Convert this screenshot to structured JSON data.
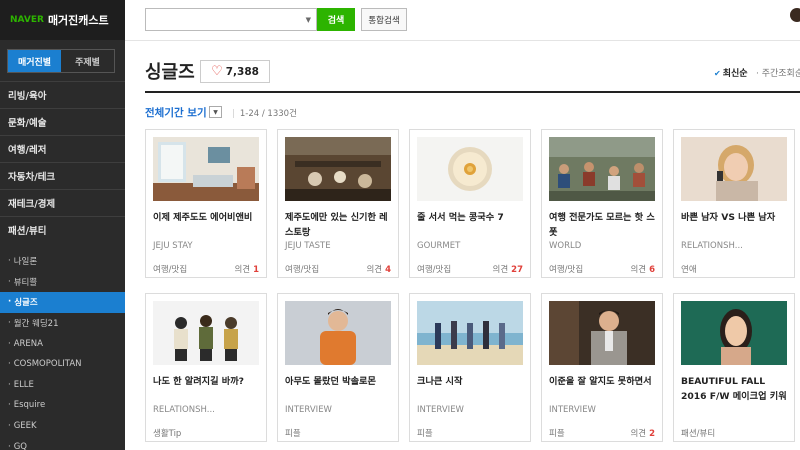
{
  "brand": {
    "naver": "NAVER",
    "title": "매거진캐스트"
  },
  "sidebar": {
    "tabs": [
      {
        "label": "매거진별",
        "active": true
      },
      {
        "label": "주제별",
        "active": false
      }
    ],
    "categories": [
      "리빙/육아",
      "문화/예술",
      "여행/레저",
      "자동차/테크",
      "재테크/경제",
      "패션/뷰티"
    ],
    "magazines": [
      "나일론",
      "뷰티쁠",
      "싱글즈",
      "월간 웨딩21",
      "ARENA",
      "COSMOPOLITAN",
      "ELLE",
      "Esquire",
      "GEEK",
      "GQ"
    ],
    "active_magazine": "싱글즈"
  },
  "topbar": {
    "search_placeholder": "",
    "search_value": "",
    "search_button": "검색",
    "total_search_button": "통합검색"
  },
  "header": {
    "title": "싱글즈",
    "likes": "7,388",
    "sort_latest": "최신순",
    "sort_weekly": "· 주간조회순"
  },
  "filter": {
    "label": "전체기간 보기",
    "range": "1-24 / 1330건"
  },
  "cards": [
    {
      "title": "이제 제주도도 에어비앤비",
      "magazine": "JEJU STAY",
      "category": "여행/맛집",
      "comment_label": "의견",
      "comments": "1",
      "thumb": "room"
    },
    {
      "title": "제주도에만 있는 신기한 레스토랑",
      "magazine": "JEJU TASTE",
      "category": "여행/맛집",
      "comment_label": "의견",
      "comments": "4",
      "thumb": "restaurant"
    },
    {
      "title": "줄 서서 먹는 콩국수 7",
      "magazine": "GOURMET",
      "category": "여행/맛집",
      "comment_label": "의견",
      "comments": "27",
      "thumb": "noodle"
    },
    {
      "title": "여행 전문가도 모르는 핫 스폿",
      "magazine": "WORLD",
      "category": "여행/맛집",
      "comment_label": "의견",
      "comments": "6",
      "thumb": "crowd"
    },
    {
      "title": "바쁜 남자 VS 나쁜 남자",
      "magazine": "RELATIONSH...",
      "category": "연애",
      "comment_label": "",
      "comments": "",
      "thumb": "woman-phone"
    },
    {
      "title": "나도 한 알려지길 바까?",
      "magazine": "RELATIONSH...",
      "category": "생활Tip",
      "comment_label": "",
      "comments": "",
      "thumb": "three-people"
    },
    {
      "title": "아무도 몰랐던 박솔로몬",
      "magazine": "INTERVIEW",
      "category": "피플",
      "comment_label": "",
      "comments": "",
      "thumb": "man-orange"
    },
    {
      "title": "크나큰 시작",
      "magazine": "INTERVIEW",
      "category": "피플",
      "comment_label": "",
      "comments": "",
      "thumb": "beach-group"
    },
    {
      "title": "이준을 잘 알지도 못하면서",
      "magazine": "INTERVIEW",
      "category": "피플",
      "comment_label": "의견",
      "comments": "2",
      "thumb": "man-suit"
    },
    {
      "title": "BEAUTIFUL FALL 2016 F/W 메이크업 키워",
      "magazine": "",
      "category": "패션/뷰티",
      "comment_label": "",
      "comments": "",
      "thumb": "woman-green"
    }
  ],
  "colors": {
    "accent_blue": "#1b7fd0",
    "naver_green": "#2db400",
    "sidebar_bg": "#2b2b2b",
    "comment_red": "#e0403a"
  }
}
